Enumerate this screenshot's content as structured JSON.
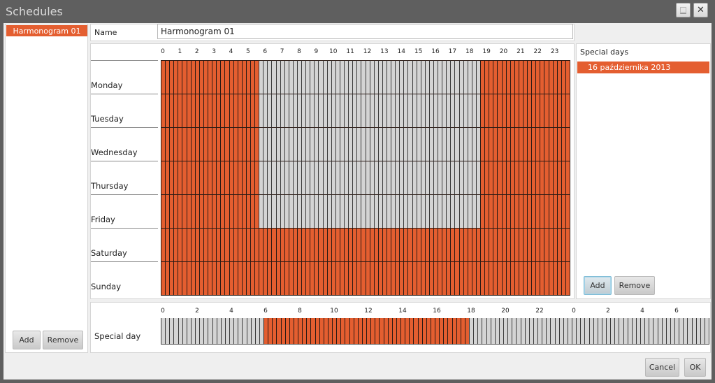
{
  "window": {
    "title": "Schedules",
    "minimize_icon": "minimize-icon",
    "close_icon": "close-icon"
  },
  "schedules_list": {
    "items": [
      {
        "label": "Harmonogram 01",
        "selected": true
      }
    ],
    "add_label": "Add",
    "remove_label": "Remove"
  },
  "name_field": {
    "label": "Name",
    "value": "Harmonogram 01"
  },
  "weekly_grid": {
    "hour_labels": [
      "0",
      "1",
      "2",
      "3",
      "4",
      "5",
      "6",
      "7",
      "8",
      "9",
      "10",
      "11",
      "12",
      "13",
      "14",
      "15",
      "16",
      "17",
      "18",
      "19",
      "20",
      "21",
      "22",
      "23"
    ],
    "slots_per_hour": 4,
    "days": [
      {
        "name": "Monday",
        "active_ranges": [
          [
            "0:00",
            "5:45"
          ],
          [
            "18:45",
            "24:00"
          ]
        ]
      },
      {
        "name": "Tuesday",
        "active_ranges": [
          [
            "0:00",
            "5:45"
          ],
          [
            "18:45",
            "24:00"
          ]
        ]
      },
      {
        "name": "Wednesday",
        "active_ranges": [
          [
            "0:00",
            "5:45"
          ],
          [
            "18:45",
            "24:00"
          ]
        ]
      },
      {
        "name": "Thursday",
        "active_ranges": [
          [
            "0:00",
            "5:45"
          ],
          [
            "18:45",
            "24:00"
          ]
        ]
      },
      {
        "name": "Friday",
        "active_ranges": [
          [
            "0:00",
            "5:45"
          ],
          [
            "18:45",
            "24:00"
          ]
        ]
      },
      {
        "name": "Saturday",
        "active_ranges": [
          [
            "0:00",
            "24:00"
          ]
        ]
      },
      {
        "name": "Sunday",
        "active_ranges": [
          [
            "0:00",
            "24:00"
          ]
        ]
      }
    ]
  },
  "special_days": {
    "title": "Special days",
    "items": [
      {
        "label": "16 października 2013",
        "selected": true
      }
    ],
    "add_label": "Add",
    "remove_label": "Remove"
  },
  "special_day_grid": {
    "label": "Special day",
    "hour_labels": [
      "0",
      "2",
      "4",
      "6",
      "8",
      "10",
      "12",
      "14",
      "16",
      "18",
      "20",
      "22",
      "0",
      "2",
      "4",
      "6"
    ],
    "total_hours": 32,
    "slots_per_hour": 4,
    "active_ranges": [
      [
        "6:00",
        "18:00"
      ]
    ]
  },
  "footer": {
    "cancel_label": "Cancel",
    "ok_label": "OK"
  },
  "colors": {
    "active": "#e45e30",
    "inactive": "#d4d4d4",
    "grid_line": "#2b1a14"
  }
}
